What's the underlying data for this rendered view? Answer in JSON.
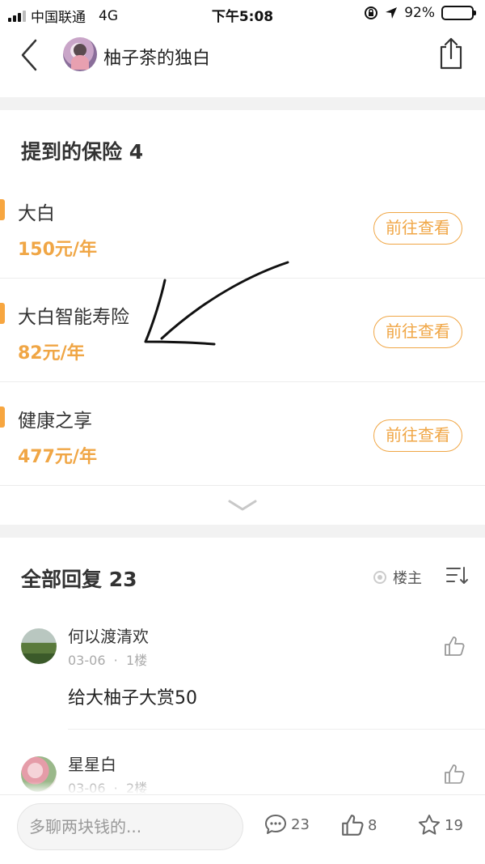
{
  "status_bar": {
    "carrier": "中国联通",
    "network": "4G",
    "time": "下午5:08",
    "battery": "92%",
    "battery_level": 0.92
  },
  "nav": {
    "title": "柚子茶的独白",
    "icons": [
      "back-chevron-icon",
      "avatar",
      "share-icon"
    ]
  },
  "insurance": {
    "title": "提到的保险 4",
    "items": [
      {
        "name": "大白",
        "price": "150元/年",
        "button": "前往查看"
      },
      {
        "name": "大白智能寿险",
        "price": "82元/年",
        "button": "前往查看"
      },
      {
        "name": "健康之享",
        "price": "477元/年",
        "button": "前往查看"
      }
    ],
    "expand_icon": "chevron-down-icon"
  },
  "replies": {
    "title": "全部回复 23",
    "op_filter_label": "楼主",
    "sort_icon": "sort-icon",
    "items": [
      {
        "user": "何以渡清欢",
        "date": "03-06",
        "floor": "1楼",
        "content": "给大柚子大赏50"
      },
      {
        "user": "星星白",
        "date": "03-06",
        "floor": "2楼",
        "content": ""
      }
    ]
  },
  "bottom_bar": {
    "input_placeholder": "多聊两块钱的...",
    "comments": "23",
    "likes": "8",
    "favorites": "19"
  },
  "colors": {
    "accent": "#f0a645",
    "text": "#333333",
    "muted": "#aaaaaa",
    "band": "#f2f2f2"
  }
}
